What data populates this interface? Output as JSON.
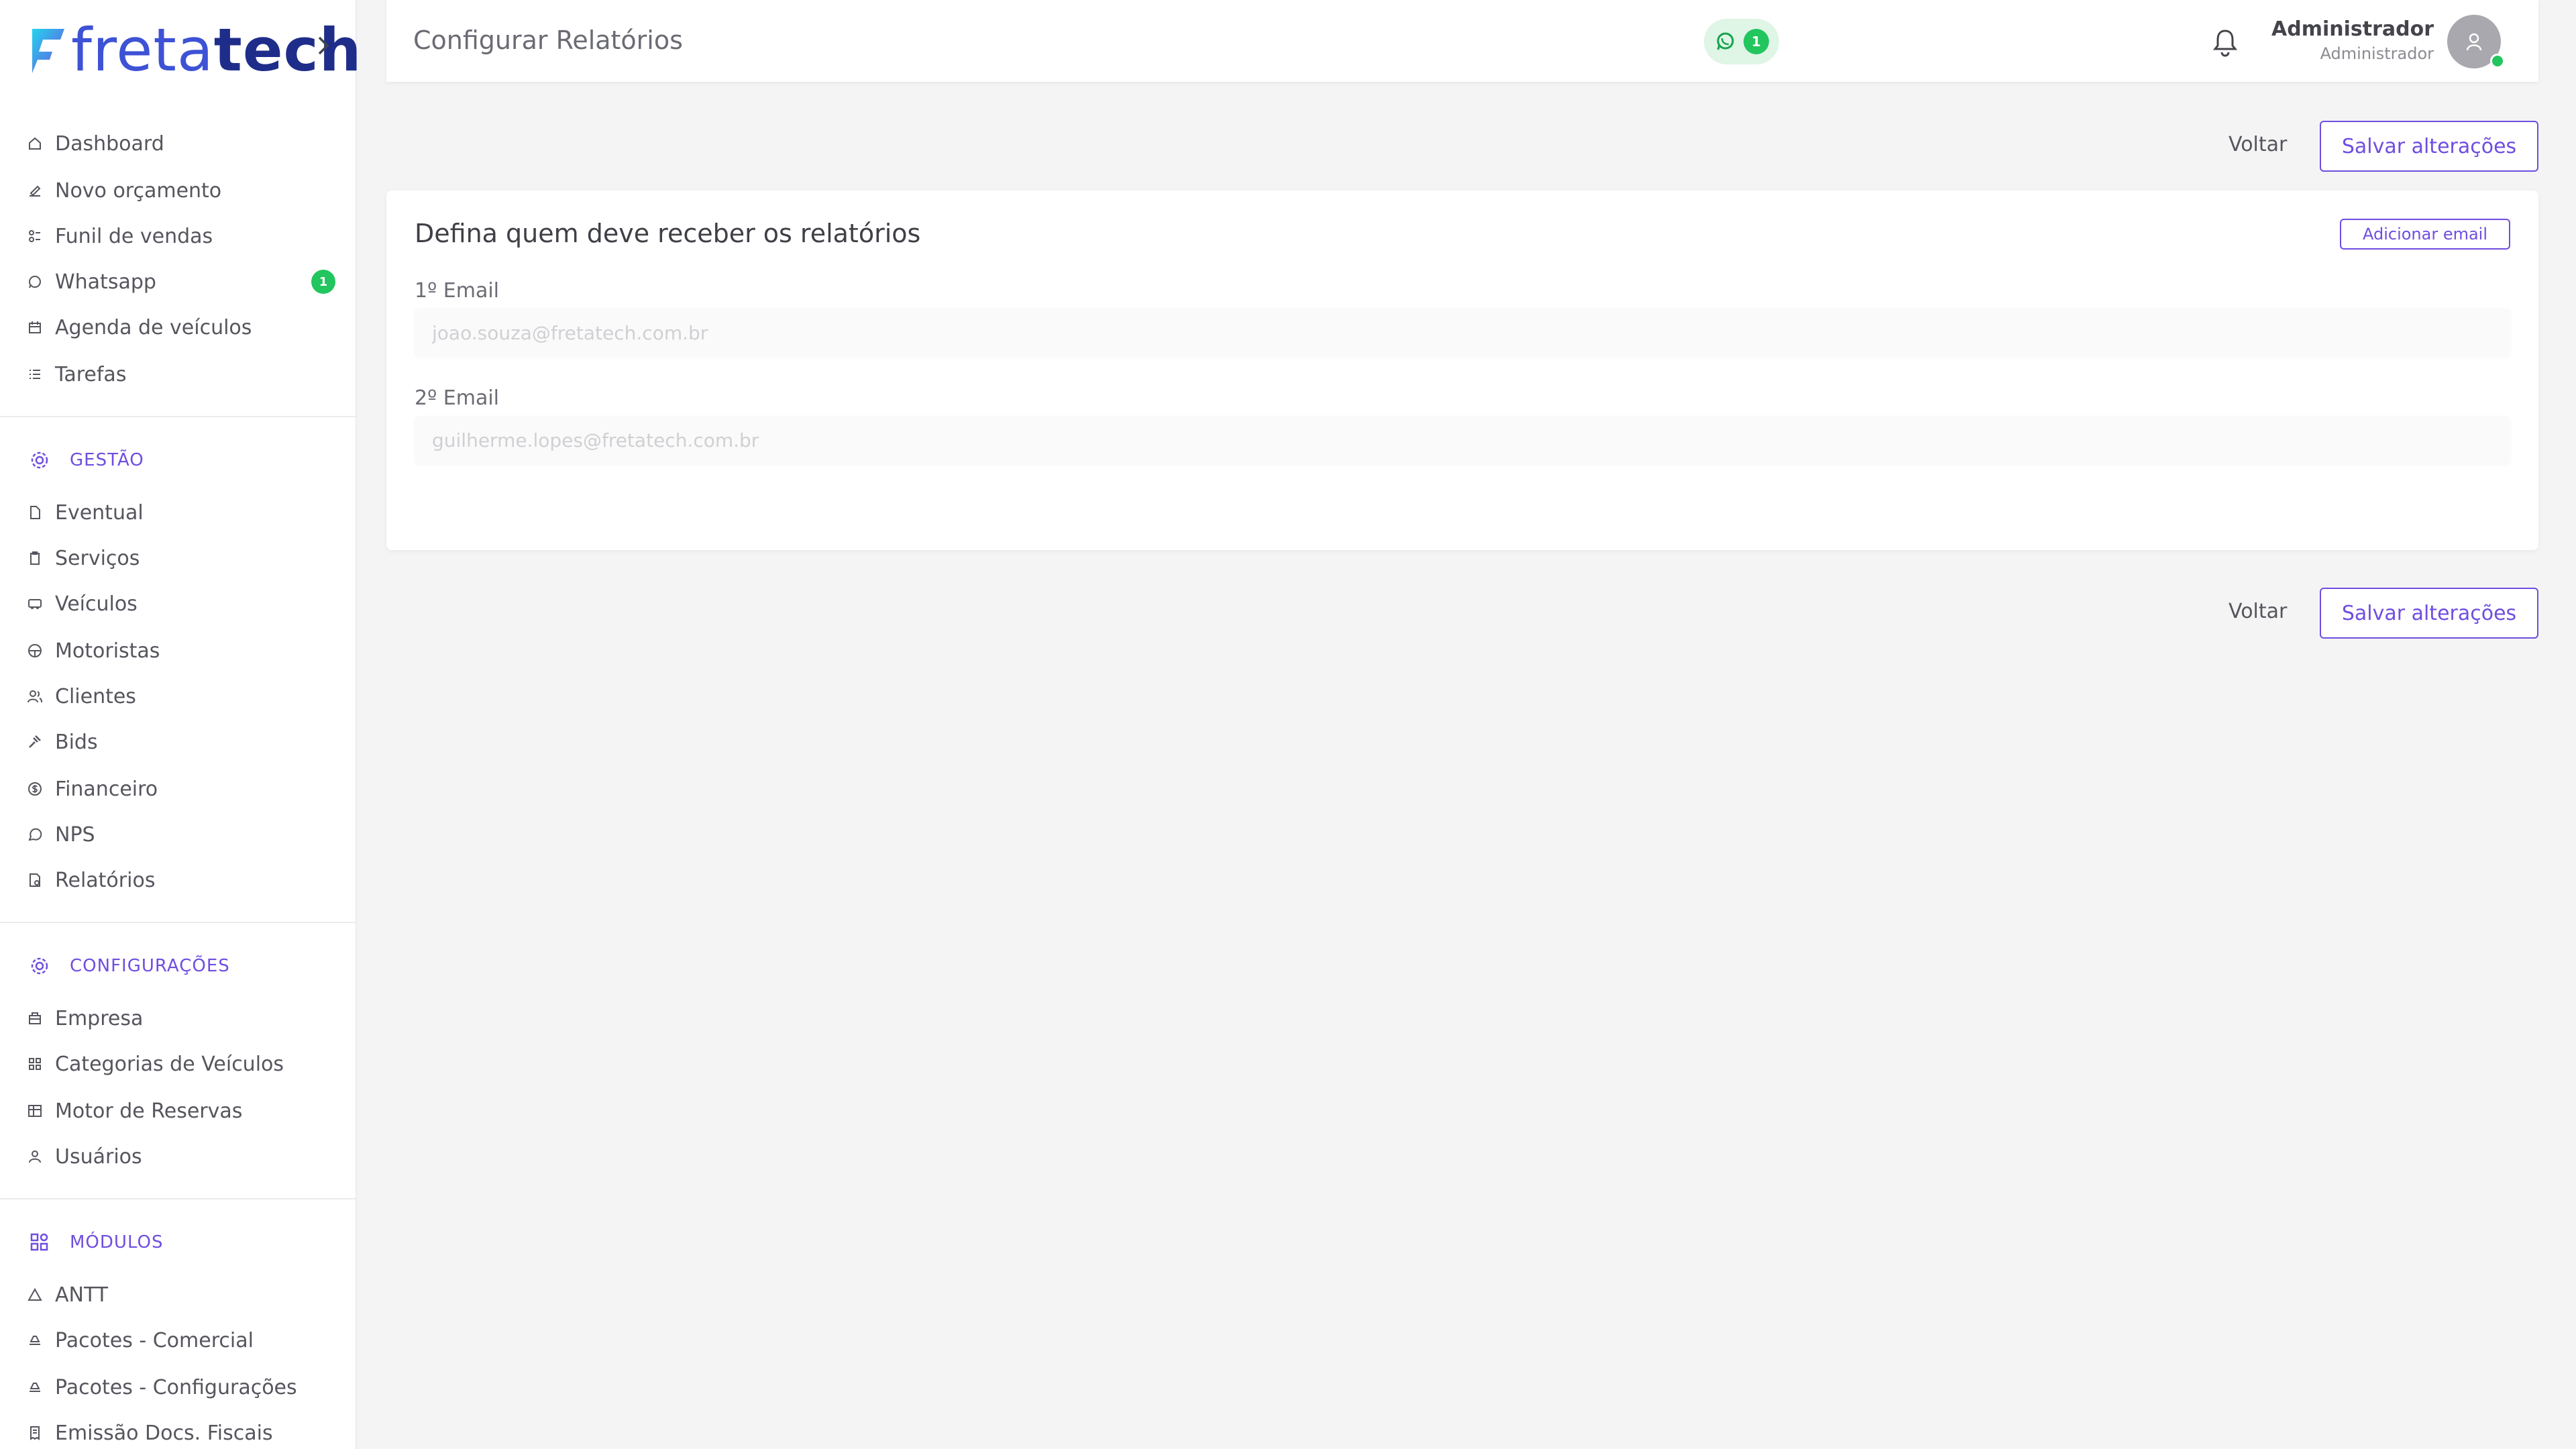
{
  "brand": {
    "name_part1": "freta",
    "name_part2": "tech",
    "primary_color": "#3d52d5",
    "accent_color": "#6f4ee0",
    "success_color": "#22c55e"
  },
  "sidebar": {
    "main_items": [
      {
        "label": "Dashboard",
        "icon": "home-icon"
      },
      {
        "label": "Novo orçamento",
        "icon": "edit-icon"
      },
      {
        "label": "Funil de vendas",
        "icon": "funnel-icon"
      },
      {
        "label": "Whatsapp",
        "icon": "whatsapp-icon",
        "badge": "1"
      },
      {
        "label": "Agenda de veículos",
        "icon": "calendar-icon"
      },
      {
        "label": "Tarefas",
        "icon": "list-icon"
      }
    ],
    "gestao": {
      "title": "GESTÃO",
      "items": [
        {
          "label": "Eventual",
          "icon": "document-icon"
        },
        {
          "label": "Serviços",
          "icon": "clipboard-icon"
        },
        {
          "label": "Veículos",
          "icon": "bus-icon"
        },
        {
          "label": "Motoristas",
          "icon": "steering-wheel-icon"
        },
        {
          "label": "Clientes",
          "icon": "users-icon"
        },
        {
          "label": "Bids",
          "icon": "gavel-icon"
        },
        {
          "label": "Financeiro",
          "icon": "dollar-icon"
        },
        {
          "label": "NPS",
          "icon": "chat-icon"
        },
        {
          "label": "Relatórios",
          "icon": "report-icon"
        }
      ]
    },
    "configuracoes": {
      "title": "CONFIGURAÇÕES",
      "items": [
        {
          "label": "Empresa",
          "icon": "building-icon"
        },
        {
          "label": "Categorias de Veículos",
          "icon": "grid-icon"
        },
        {
          "label": "Motor de Reservas",
          "icon": "table-icon"
        },
        {
          "label": "Usuários",
          "icon": "user-icon"
        }
      ]
    },
    "modulos": {
      "title": "MÓDULOS",
      "items": [
        {
          "label": "ANTT",
          "icon": "triangle-icon"
        },
        {
          "label": "Pacotes - Comercial",
          "icon": "package-icon"
        },
        {
          "label": "Pacotes - Configurações",
          "icon": "package-icon"
        },
        {
          "label": "Emissão Docs. Fiscais",
          "icon": "receipt-icon"
        }
      ]
    }
  },
  "header": {
    "title": "Configurar Relatórios",
    "whatsapp_count": "1",
    "user_name": "Administrador",
    "user_role": "Administrador"
  },
  "actions": {
    "back_label": "Voltar",
    "save_label": "Salvar alterações"
  },
  "card": {
    "title": "Defina quem deve receber os relatórios",
    "add_email_label": "Adicionar email",
    "fields": [
      {
        "label": "1º Email",
        "value": "joao.souza@fretatech.com.br"
      },
      {
        "label": "2º Email",
        "value": "guilherme.lopes@fretatech.com.br"
      }
    ]
  }
}
